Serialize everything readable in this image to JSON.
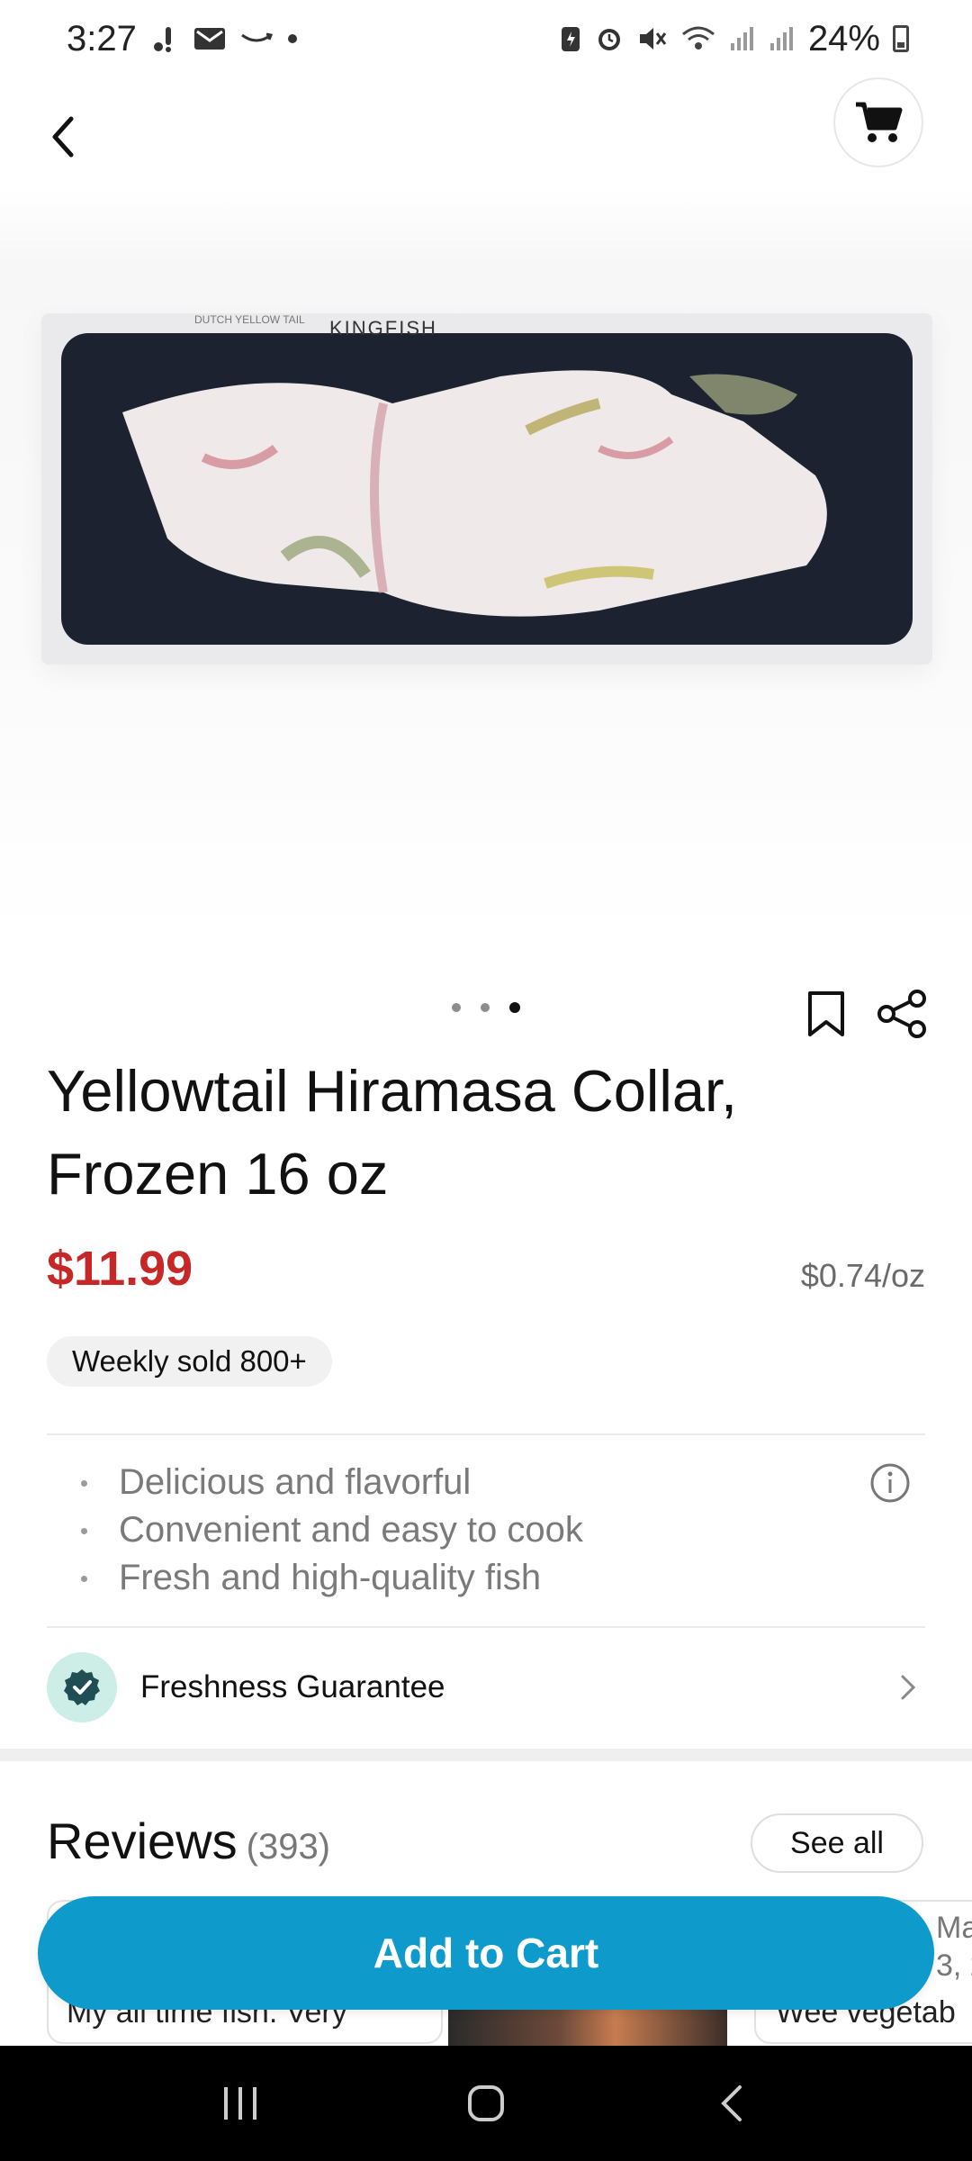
{
  "status_bar": {
    "time": "3:27",
    "battery": "24%",
    "icons_left": [
      "notification-icon",
      "mail-icon",
      "amazon-icon",
      "dot-icon"
    ],
    "icons_right": [
      "battery-saver-icon",
      "alarm-icon",
      "mute-icon",
      "wifi-icon",
      "signal-icon",
      "signal-icon"
    ]
  },
  "header": {
    "back_icon": "chevron-left-icon",
    "cart_icon": "cart-icon"
  },
  "gallery": {
    "image_label": "KINGFISH",
    "tray_brand": "DUTCH YELLOW TAIL",
    "page_count": 3,
    "active_index": 2
  },
  "product": {
    "title": "Yellowtail Hiramasa Collar, Frozen 16 oz",
    "price": "$11.99",
    "unit_price": "$0.74/oz",
    "sold_badge": "Weekly sold 800+",
    "features": [
      "Delicious and flavorful",
      "Convenient and easy to cook",
      "Fresh and high-quality fish"
    ],
    "freshness_label": "Freshness Guarantee"
  },
  "reviews": {
    "title": "Reviews",
    "count": "(393)",
    "see_all": "See all",
    "card1_text": "My all time fish. Very",
    "card2_header": "Ma",
    "card2_date": "3, 2",
    "card2_text": "Wee vegetab"
  },
  "actions": {
    "add_to_cart": "Add to Cart"
  },
  "colors": {
    "price": "#c62828",
    "accent": "#0e9bcc",
    "fresh_badge_bg": "#cdeee7",
    "fresh_check": "#1f4f55"
  }
}
